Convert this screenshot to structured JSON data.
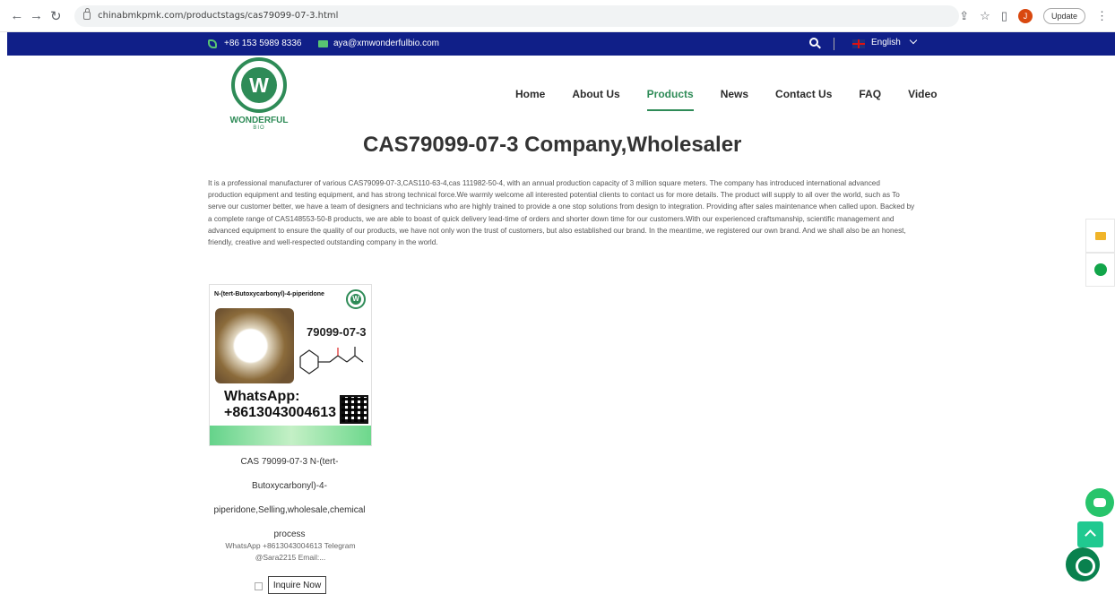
{
  "browser": {
    "url": "chinabmkpmk.com/productstags/cas79099-07-3.html",
    "update_label": "Update",
    "profile_initial": "J"
  },
  "topbar": {
    "phone": "+86 153 5989 8336",
    "email": "aya@xmwonderfulbio.com",
    "language": "English"
  },
  "logo": {
    "letter": "W",
    "name": "WONDERFUL",
    "sub": "BIO"
  },
  "nav": {
    "items": [
      "Home",
      "About Us",
      "Products",
      "News",
      "Contact Us",
      "FAQ",
      "Video"
    ],
    "active": "Products"
  },
  "page": {
    "title": "CAS79099-07-3 Company,Wholesaler",
    "description": "It is a professional manufacturer of various CAS79099-07-3,CAS110-63-4,cas 111982-50-4, with an annual production capacity of 3 million square meters. The company has introduced international advanced production equipment and testing equipment, and has strong technical force.We warmly welcome all interested potential clients to contact us for more details. The product will supply to all over the world, such as To serve our customer better, we have a team of designers and technicians who are highly trained to provide a one stop solutions from design to integration. Providing after sales maintenance when called upon. Backed by a complete range of CAS148553-50-8 products, we are able to boast of quick delivery lead-time of orders and shorter down time for our customers.With our experienced craftsmanship, scientific management and advanced equipment to ensure the quality of our products, we have not only won the trust of customers, but also established our brand. In the meantime, we registered our own brand. And we shall also be an honest, friendly, creative and well-respected outstanding company in the world."
  },
  "product": {
    "image_title": "N-(tert-Butoxycarbonyl)-4-piperidone",
    "image_cas": "79099-07-3",
    "image_whatsapp_label": "WhatsApp:",
    "image_whatsapp_number": "+8613043004613",
    "image_logo_letter": "W",
    "name_lines": [
      "CAS 79099-07-3 N-(tert-",
      "Butoxycarbonyl)-4-",
      "piperidone,Selling,wholesale,chemical",
      "process"
    ],
    "summary_lines": [
      "WhatsApp +8613043004613 Telegram",
      "@Sara2215 Email:..."
    ],
    "inquire_label": "Inquire Now"
  },
  "icons": {
    "back": "arrow-left-icon",
    "forward": "arrow-right-icon",
    "reload": "reload-icon",
    "share": "share-icon",
    "star": "star-icon",
    "sidebar": "sidebar-icon",
    "menu": "more-vertical-icon",
    "phone": "phone-icon",
    "mail": "mail-icon",
    "search": "search-icon",
    "flag": "uk-flag-icon",
    "chevron": "chevron-down-icon",
    "side_mail": "mail-icon",
    "side_whatsapp": "whatsapp-icon",
    "chat": "chat-bubble-icon",
    "top": "chevron-up-icon",
    "support": "support-chat-icon"
  },
  "colors": {
    "topbar": "#101f88",
    "accent": "#2e8b57",
    "chat": "#27c46b",
    "support": "#09814e"
  }
}
